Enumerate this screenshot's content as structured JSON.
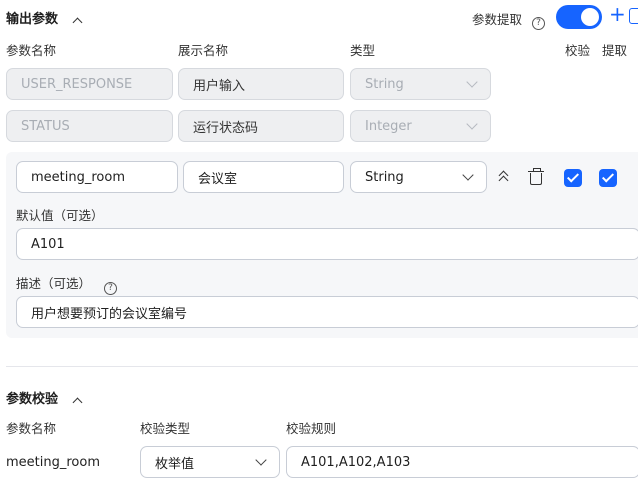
{
  "output": {
    "title": "输出参数",
    "extract_label": "参数提取",
    "extract_enabled": true,
    "headers": {
      "name": "参数名称",
      "display": "展示名称",
      "type": "类型",
      "validate": "校验",
      "extract": "提取"
    },
    "rows": [
      {
        "name": "USER_RESPONSE",
        "display": "用户输入",
        "type": "String"
      },
      {
        "name": "STATUS",
        "display": "运行状态码",
        "type": "Integer"
      }
    ],
    "active_row": {
      "name": "meeting_room",
      "display": "会议室",
      "type": "String",
      "validate_checked": true,
      "extract_checked": true,
      "default_label": "默认值（可选）",
      "default_value": "A101",
      "desc_label": "描述（可选）",
      "desc_value": "用户想要预订的会议室编号"
    }
  },
  "validation": {
    "title": "参数校验",
    "headers": {
      "name": "参数名称",
      "type": "校验类型",
      "rule": "校验规则"
    },
    "row": {
      "name": "meeting_room",
      "type": "枚举值",
      "rule": "A101,A102,A103"
    }
  },
  "colors": {
    "accent": "#1664ff",
    "disabled_bg": "#eeeff1",
    "panel_bg": "#f6f7f9"
  }
}
